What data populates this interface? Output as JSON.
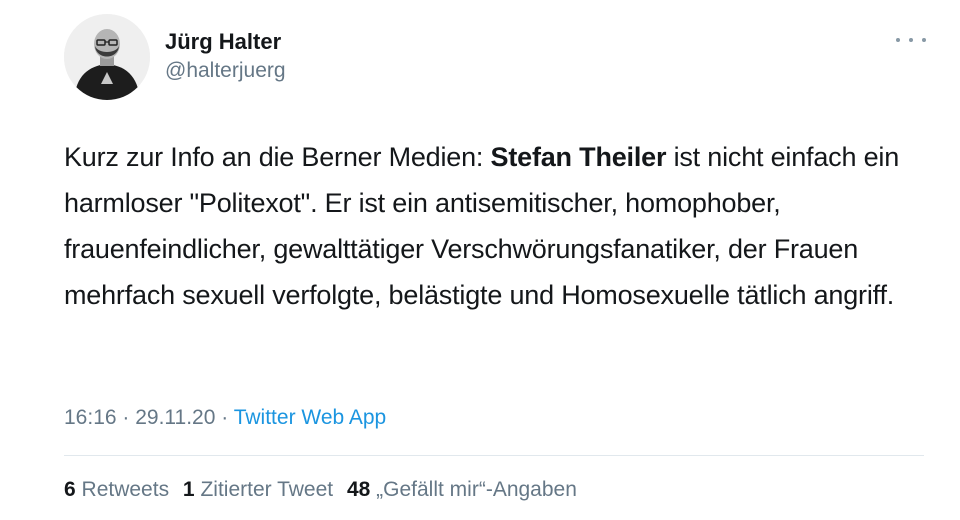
{
  "author": {
    "display_name": "Jürg Halter",
    "handle": "@halterjuerg"
  },
  "menu_icon": "more-horizontal-icon",
  "tweet": {
    "text_part1": "Kurz zur Info an die Berner Medien: ",
    "text_bold": "Stefan Theiler",
    "text_part2": " ist nicht einfach ein harmloser \"Politexot\". Er ist ein antisemitischer, homophober, frauenfeindlicher, gewalttätiger Verschwörungsfanatiker, der Frauen mehrfach sexuell verfolgte, belästigte und Homosexuelle tätlich angriff."
  },
  "meta": {
    "time": "16:16",
    "sep1": " · ",
    "date": "29.11.20",
    "sep2": " · ",
    "source": "Twitter Web App"
  },
  "stats": {
    "retweets_count": "6",
    "retweets_label": "Retweets",
    "quotes_count": "1",
    "quotes_label": "Zitierter Tweet",
    "likes_count": "48",
    "likes_label": "„Gefällt mir“-Angaben"
  },
  "colors": {
    "text": "#14171a",
    "secondary": "#657786",
    "link": "#1b95e0",
    "divider": "#e1e8ed"
  }
}
